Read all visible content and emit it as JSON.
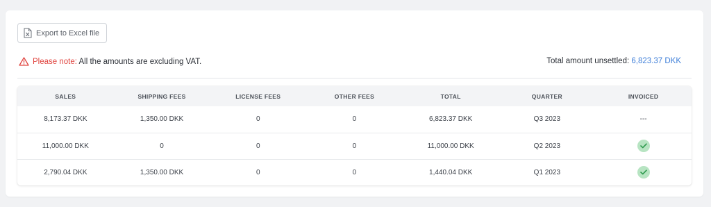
{
  "toolbar": {
    "export_label": "Export to Excel file"
  },
  "notice": {
    "label": "Please note:",
    "text": "All the amounts are excluding VAT."
  },
  "summary": {
    "label": "Total amount unsettled:",
    "amount": "6,823.37 DKK"
  },
  "table": {
    "headers": [
      "SALES",
      "SHIPPING FEES",
      "LICENSE FEES",
      "OTHER FEES",
      "TOTAL",
      "QUARTER",
      "INVOICED"
    ],
    "rows": [
      {
        "sales": "8,173.37 DKK",
        "shipping": "1,350.00 DKK",
        "license": "0",
        "other": "0",
        "total": "6,823.37 DKK",
        "quarter": "Q3 2023",
        "invoiced": "---"
      },
      {
        "sales": "11,000.00 DKK",
        "shipping": "0",
        "license": "0",
        "other": "0",
        "total": "11,000.00 DKK",
        "quarter": "Q2 2023",
        "invoiced": "check-icon"
      },
      {
        "sales": "2,790.04 DKK",
        "shipping": "1,350.00 DKK",
        "license": "0",
        "other": "0",
        "total": "1,440.04 DKK",
        "quarter": "Q1 2023",
        "invoiced": "check-icon"
      }
    ]
  },
  "colors": {
    "warning": "#e0443f",
    "link_amount": "#3f7fd9",
    "check_bg": "#b7e4c2",
    "check_fg": "#2e9a4e"
  }
}
